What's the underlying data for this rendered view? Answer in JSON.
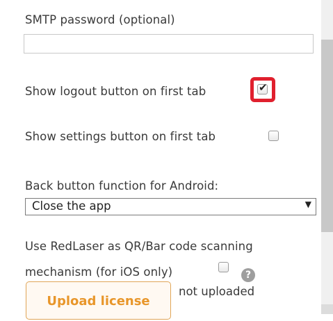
{
  "settings": {
    "smtp_password": {
      "label": "SMTP password (optional)",
      "value": ""
    },
    "show_logout": {
      "label": "Show logout button on first tab",
      "checked": true
    },
    "show_settings": {
      "label": "Show settings button on first tab",
      "checked": false
    },
    "back_button": {
      "label": "Back button function for Android:",
      "selected": "Close the app"
    },
    "redlaser": {
      "label_line1": "Use RedLaser as QR/Bar code scanning",
      "label_line2": "mechanism (for iOS only)",
      "checked": false,
      "help_glyph": "?"
    },
    "license": {
      "button_label": "Upload license",
      "status": "not uploaded"
    }
  },
  "colors": {
    "highlight": "#e0202e",
    "upload_text": "#e8962a",
    "upload_border": "#e0a557"
  },
  "icons": {
    "checkmark": "check-icon",
    "dropdown": "dropdown-arrow-icon",
    "help": "help-icon"
  }
}
